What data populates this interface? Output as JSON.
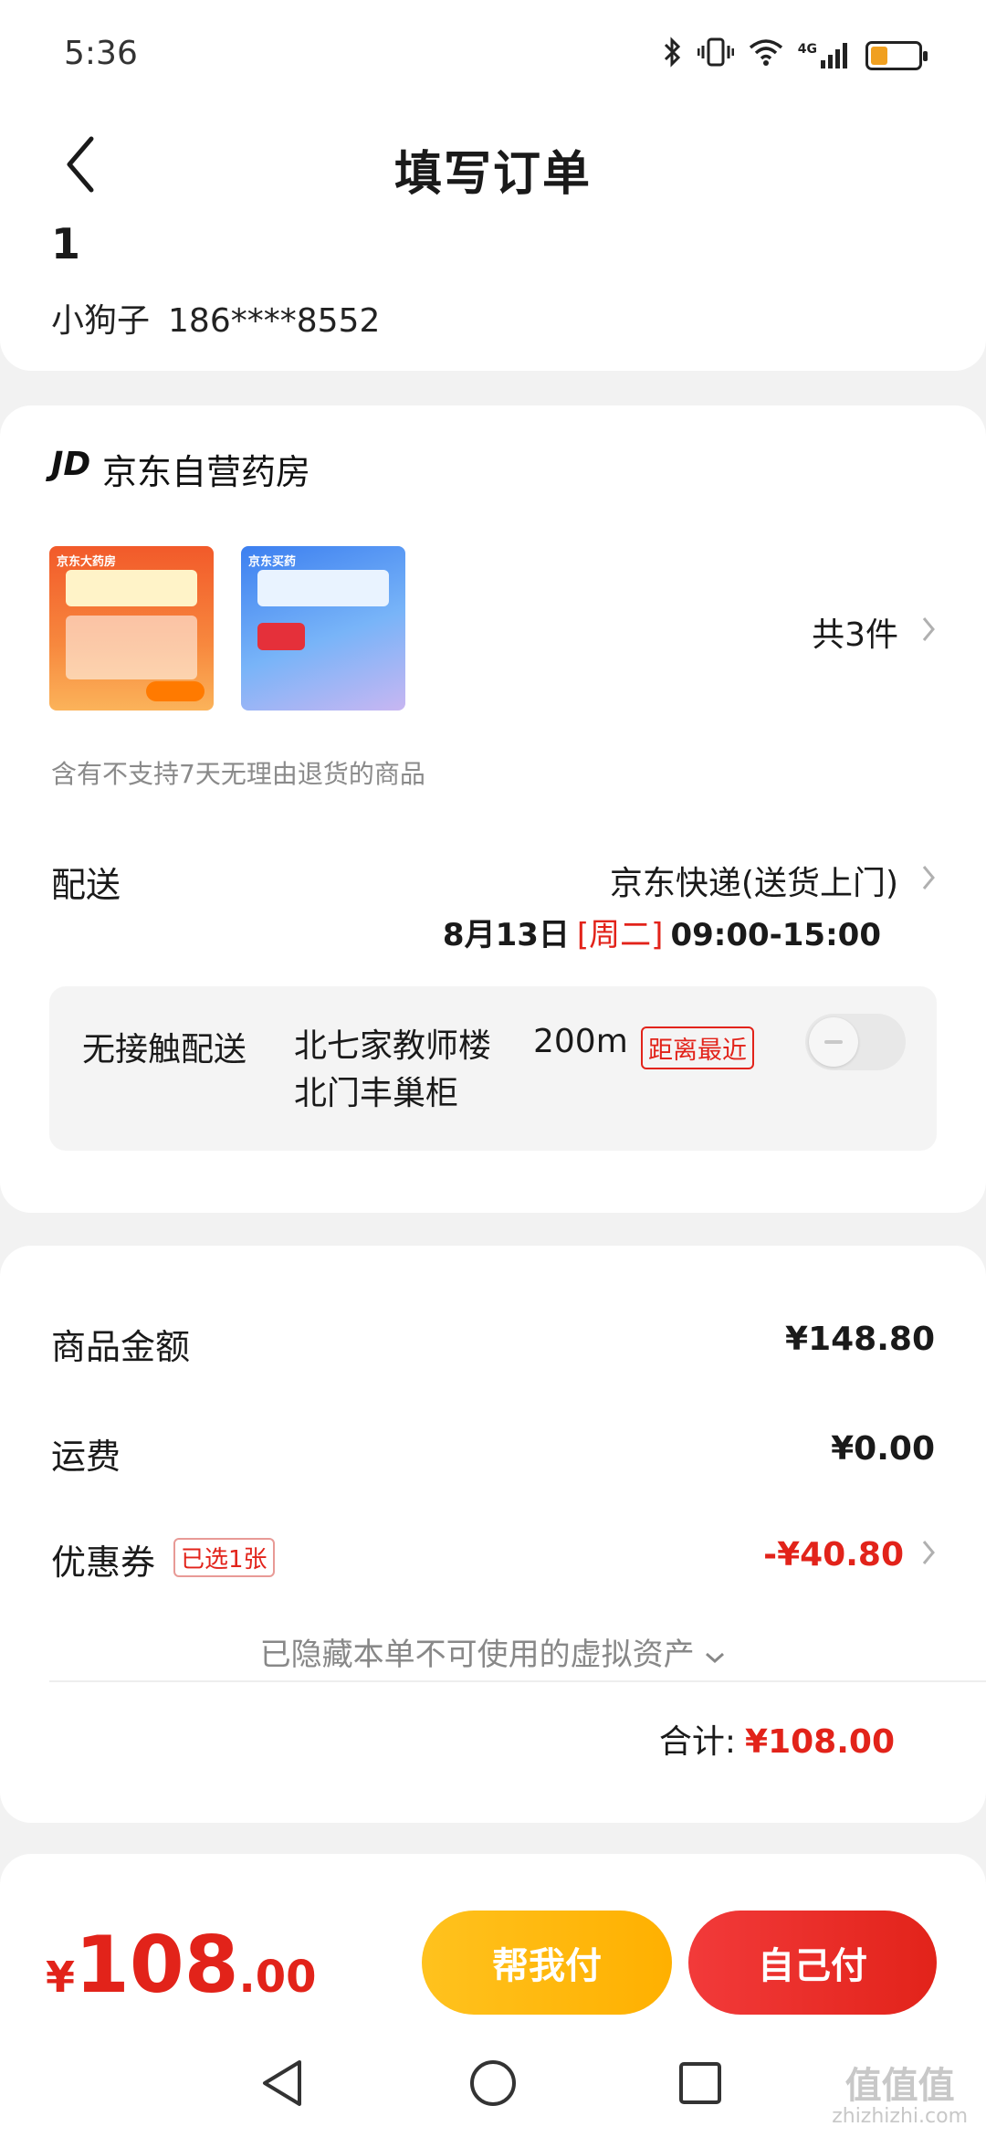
{
  "status_bar": {
    "time": "5:36",
    "network": "4G",
    "battery_level": 0.35,
    "icons": [
      "bluetooth-icon",
      "vibrate-icon",
      "wifi-icon",
      "signal-icon",
      "battery-icon"
    ]
  },
  "header": {
    "title": "填写订单",
    "back_icon": "chevron-left-icon"
  },
  "address": {
    "line": "1",
    "name": "小狗子",
    "phone": "186****8552"
  },
  "store": {
    "logo": "JD",
    "name": "京东自营药房",
    "product_images": [
      {
        "tag": "京东大药房"
      },
      {
        "tag": "京东买药"
      }
    ],
    "quantity_label": "共3件",
    "return_notice": "含有不支持7天无理由退货的商品",
    "delivery": {
      "label": "配送",
      "method": "京东快递(送货上门)",
      "date": "8月13日",
      "weekday": "[周二]",
      "time": "09:00-15:00"
    },
    "contactless": {
      "label": "无接触配送",
      "location_line1": "北七家教师楼",
      "location_line2": "北门丰巢柜",
      "distance": "200m",
      "badge": "距离最近",
      "enabled": false
    }
  },
  "amounts": {
    "goods_label": "商品金额",
    "goods_value": "¥148.80",
    "shipping_label": "运费",
    "shipping_value": "¥0.00",
    "coupon_label": "优惠券",
    "coupon_badge": "已选1张",
    "coupon_value": "-¥40.80",
    "hidden_assets": "已隐藏本单不可使用的虚拟资产",
    "total_label": "合计:",
    "total_value": "¥108.00"
  },
  "bottom_bar": {
    "currency": "¥",
    "amount_int": "108",
    "amount_dec": ".00",
    "help_pay_label": "帮我付",
    "self_pay_label": "自己付"
  },
  "nav": {
    "back": "nav-back-icon",
    "home": "nav-home-icon",
    "recents": "nav-recents-icon"
  },
  "watermark": {
    "text": "值值值",
    "subtext": "zhizhizhi.com"
  },
  "colors": {
    "accent_red": "#e2231a",
    "help_yellow": "#ffb000",
    "background": "#f2f2f2"
  }
}
